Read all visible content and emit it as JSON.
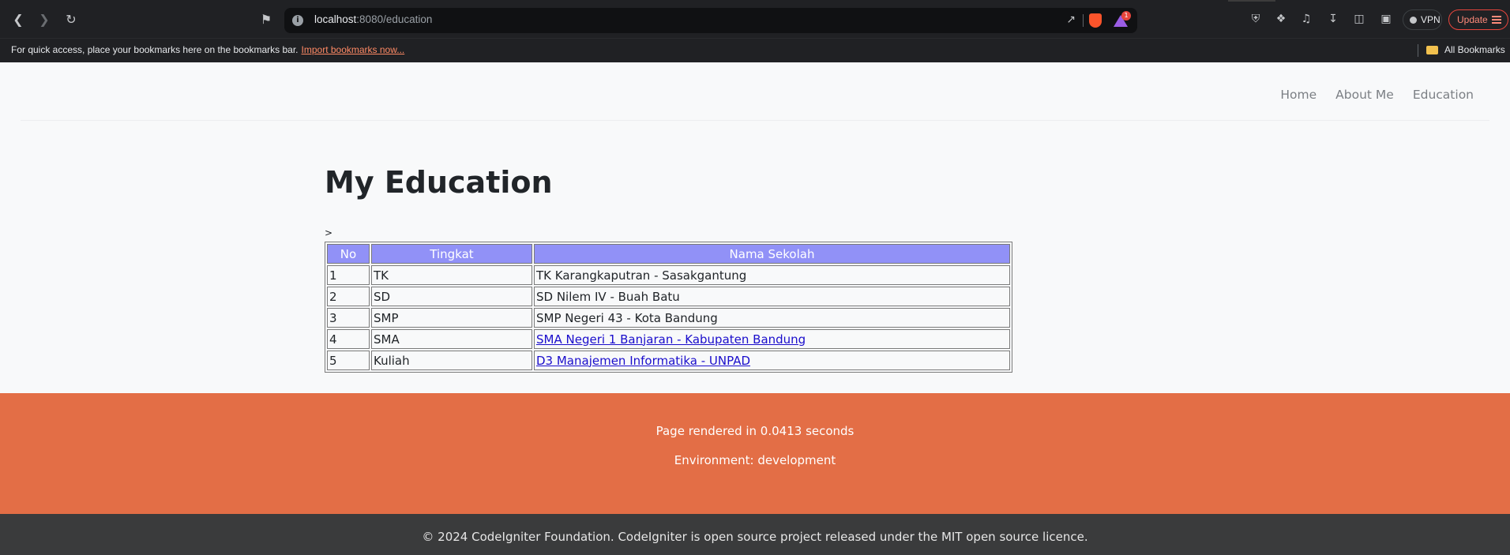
{
  "browser": {
    "url_host": "localhost",
    "url_path": ":8080/education",
    "vpn_label": "VPN",
    "update_label": "Update",
    "notification_count": "1"
  },
  "bookmarks_bar": {
    "message": "For quick access, place your bookmarks here on the bookmarks bar.",
    "import_link": "Import bookmarks now...",
    "all_bookmarks": "All Bookmarks"
  },
  "navbar": {
    "items": [
      {
        "label": "Home"
      },
      {
        "label": "About Me"
      },
      {
        "label": "Education"
      }
    ]
  },
  "main": {
    "title": "My Education",
    "stray_text": ">",
    "table": {
      "headers": [
        "No",
        "Tingkat",
        "Nama Sekolah"
      ],
      "rows": [
        {
          "no": "1",
          "tingkat": "TK",
          "sekolah": "TK Karangkaputran - Sasakgantung",
          "link": false
        },
        {
          "no": "2",
          "tingkat": "SD",
          "sekolah": "SD Nilem IV - Buah Batu",
          "link": false
        },
        {
          "no": "3",
          "tingkat": "SMP",
          "sekolah": "SMP Negeri 43 - Kota Bandung",
          "link": false
        },
        {
          "no": "4",
          "tingkat": "SMA",
          "sekolah": "SMA Negeri 1 Banjaran - Kabupaten Bandung",
          "link": true
        },
        {
          "no": "5",
          "tingkat": "Kuliah",
          "sekolah": "D3 Manajemen Informatika - UNPAD",
          "link": true
        }
      ]
    }
  },
  "footer": {
    "render_time": "Page rendered in 0.0413 seconds",
    "environment": "Environment: development",
    "copyright": "© 2024 CodeIgniter Foundation. CodeIgniter is open source project released under the MIT open source licence."
  },
  "colors": {
    "table_header": "#9191f7",
    "footer_orange": "#e36e46",
    "footer_dark": "#3a3b3c"
  }
}
